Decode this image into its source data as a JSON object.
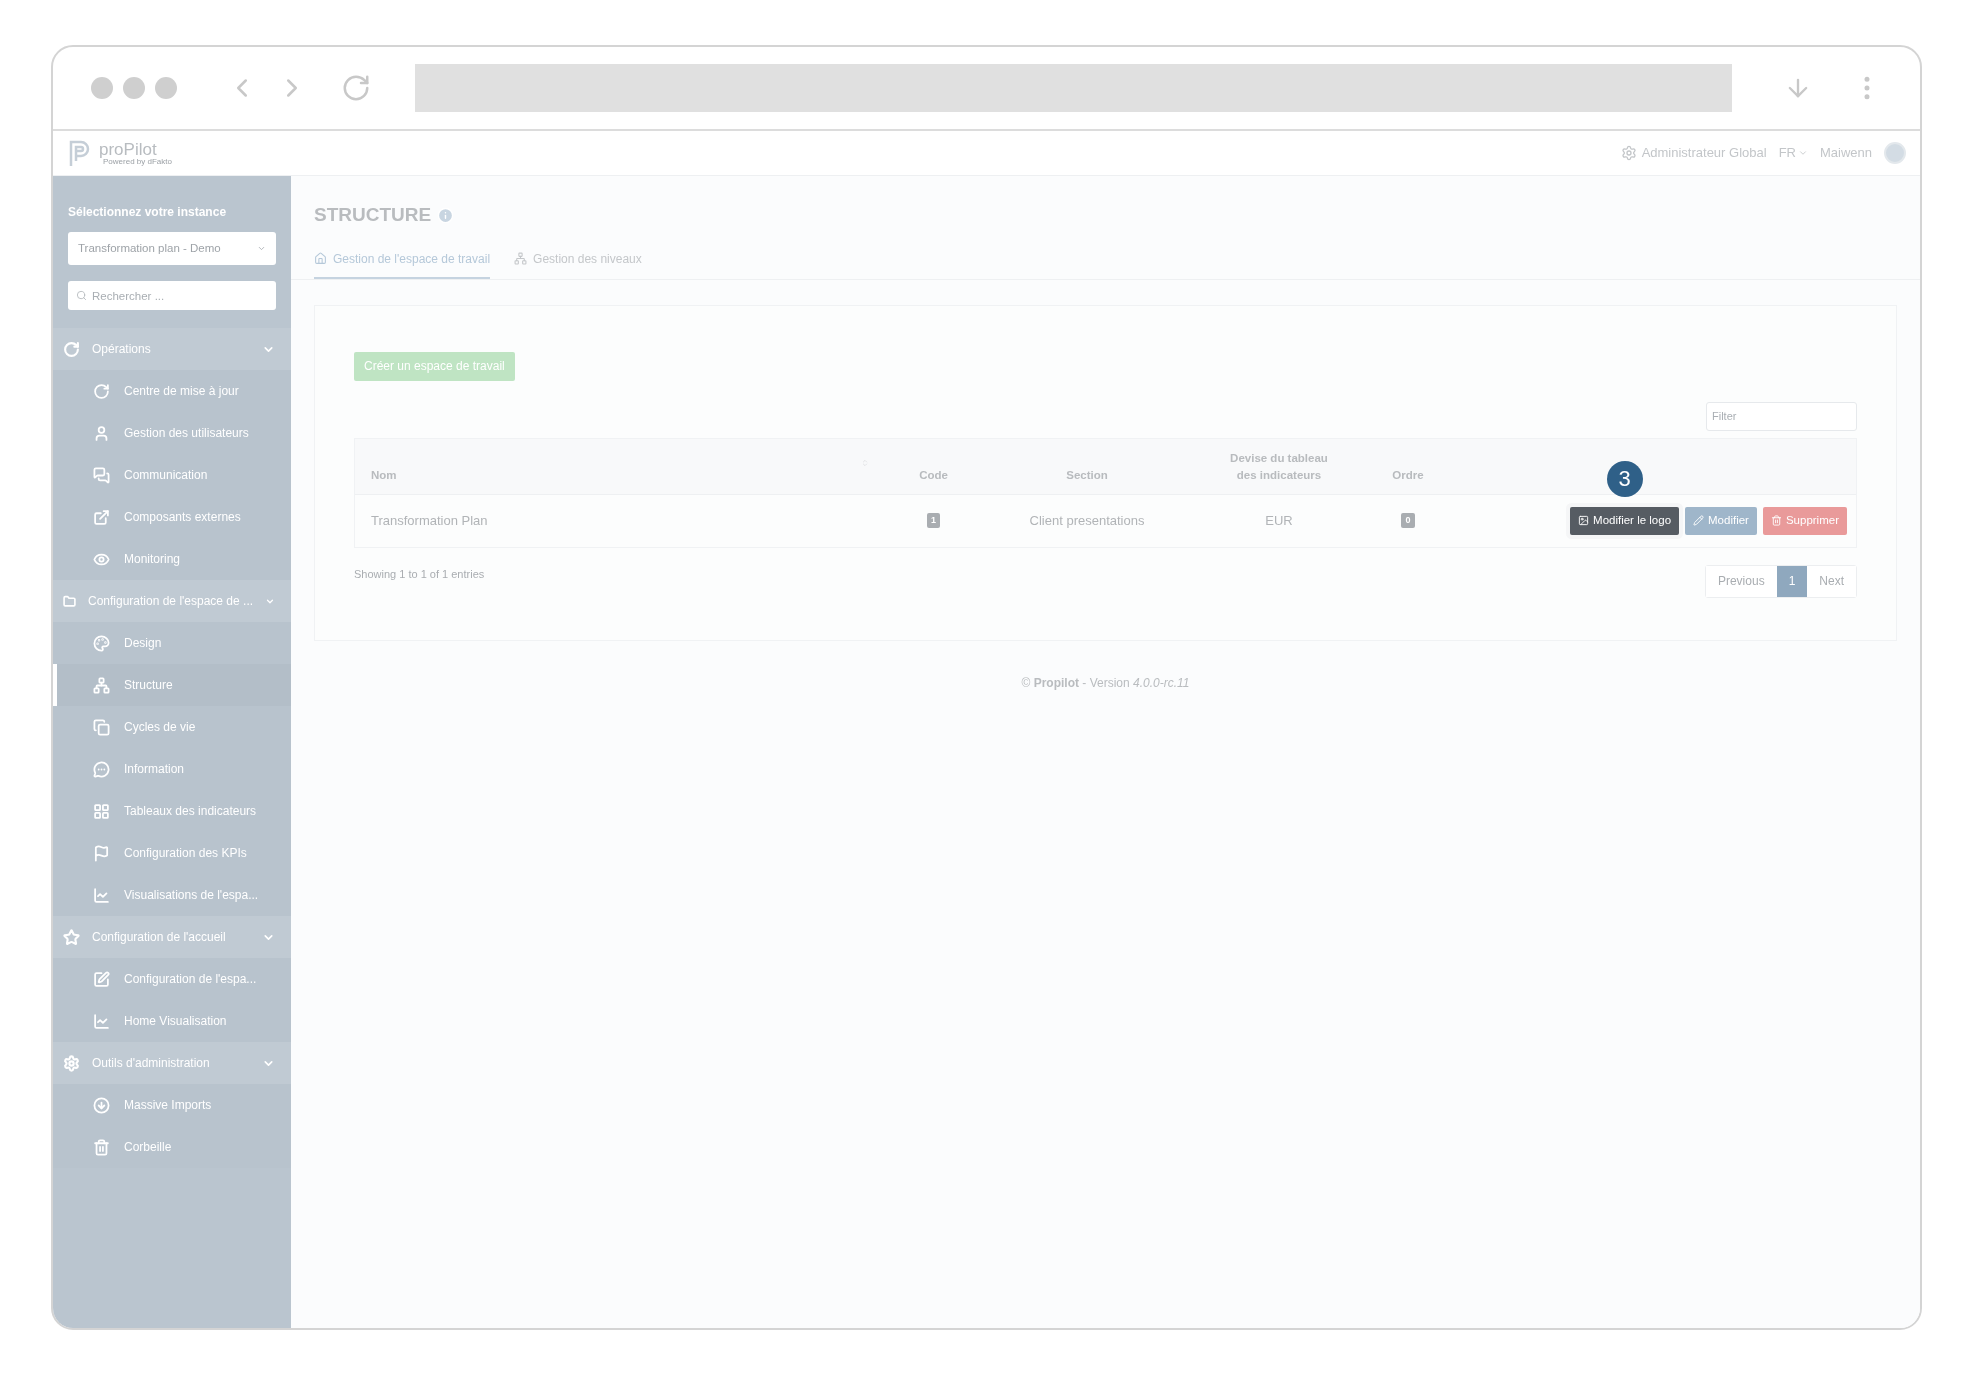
{
  "app_header": {
    "logo": "proPilot",
    "logo_tagline": "Powered by dFakto",
    "role": "Administrateur Global",
    "language": "FR",
    "user": "Maiwenn"
  },
  "sidebar": {
    "instance_label": "Sélectionnez votre instance",
    "instance_value": "Transformation plan - Demo",
    "search": {
      "placeholder": "Rechercher ..."
    },
    "sections": [
      {
        "label": "Opérations",
        "expanded": true,
        "items": [
          {
            "label": "Centre de mise à jour",
            "selected": false
          },
          {
            "label": "Gestion des utilisateurs",
            "selected": false
          },
          {
            "label": "Communication",
            "selected": false
          },
          {
            "label": "Composants externes",
            "selected": false
          },
          {
            "label": "Monitoring",
            "selected": false
          }
        ]
      },
      {
        "label": "Configuration de l'espace de ...",
        "expanded": true,
        "items": [
          {
            "label": "Design",
            "selected": false
          },
          {
            "label": "Structure",
            "selected": true
          },
          {
            "label": "Cycles de vie",
            "selected": false
          },
          {
            "label": "Information",
            "selected": false
          },
          {
            "label": "Tableaux des indicateurs",
            "selected": false
          },
          {
            "label": "Configuration des KPIs",
            "selected": false
          },
          {
            "label": "Visualisations de l'espa...",
            "selected": false
          }
        ]
      },
      {
        "label": "Configuration de l'accueil",
        "expanded": true,
        "items": [
          {
            "label": "Configuration de l'espa...",
            "selected": false
          },
          {
            "label": "Home Visualisation",
            "selected": false
          }
        ]
      },
      {
        "label": "Outils d'administration",
        "expanded": true,
        "items": [
          {
            "label": "Massive Imports",
            "selected": false
          },
          {
            "label": "Corbeille",
            "selected": false
          }
        ]
      }
    ]
  },
  "page": {
    "title": "STRUCTURE",
    "tabs": [
      {
        "label": "Gestion de l'espace de travail",
        "selected": true
      },
      {
        "label": "Gestion des niveaux",
        "selected": false
      }
    ],
    "create_button": "Créer un espace de travail",
    "filter": {
      "placeholder": "Filter"
    },
    "table": {
      "columns": [
        "Nom",
        "Code",
        "Section",
        "Devise du tableau des indicateurs",
        "Ordre"
      ],
      "rows": [
        {
          "cells": [
            {
              "kind": "text",
              "text": "Transformation Plan"
            },
            {
              "kind": "badge",
              "text": "1"
            },
            {
              "kind": "text",
              "text": "Client presentations"
            },
            {
              "kind": "text",
              "text": "EUR"
            },
            {
              "kind": "badge",
              "text": "0"
            }
          ],
          "actions": [
            {
              "kind": "logo",
              "label": "Modifier le logo",
              "highlighted": true
            },
            {
              "kind": "edit",
              "label": "Modifier",
              "highlighted": false
            },
            {
              "kind": "delete",
              "label": "Supprimer",
              "highlighted": false
            }
          ]
        }
      ]
    },
    "step_badge": "3",
    "info": "Showing 1 to 1 of 1 entries",
    "pagination": [
      {
        "label": "Previous",
        "selected": false
      },
      {
        "label": "1",
        "selected": true
      },
      {
        "label": "Next",
        "selected": false
      }
    ],
    "footer": "© **Propilot** - Version *4.0.0-rc.11*"
  }
}
